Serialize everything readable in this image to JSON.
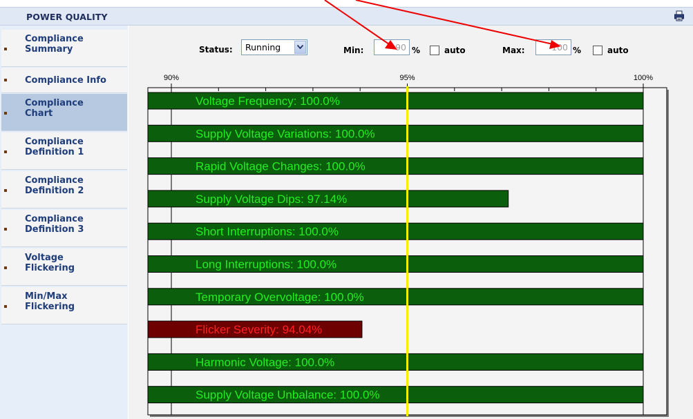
{
  "header": {
    "title": "POWER QUALITY",
    "print_icon": "printer-icon"
  },
  "sidebar": {
    "items": [
      {
        "label": "Compliance\nSummary",
        "active": false
      },
      {
        "label": "Compliance Info",
        "active": false
      },
      {
        "label": "Compliance\nChart",
        "active": true
      },
      {
        "label": "Compliance\nDefinition 1",
        "active": false
      },
      {
        "label": "Compliance\nDefinition 2",
        "active": false
      },
      {
        "label": "Compliance\nDefinition 3",
        "active": false
      },
      {
        "label": "Voltage\nFlickering",
        "active": false
      },
      {
        "label": "Min/Max\nFlickering",
        "active": false
      }
    ]
  },
  "controls": {
    "status_label": "Status:",
    "status_value": "Running",
    "min_label": "Min:",
    "min_value": "90",
    "min_unit": "%",
    "min_auto_label": "auto",
    "max_label": "Max:",
    "max_value": "100",
    "max_unit": "%",
    "max_auto_label": "auto"
  },
  "colors": {
    "bar_ok": "#0b5e0b",
    "bar_fail": "#6e0000",
    "label_ok": "#22ee22",
    "label_fail": "#ff2020",
    "threshold_line": "#f4f000",
    "annotation_arrow": "#ee0000"
  },
  "chart_data": {
    "type": "bar",
    "orientation": "horizontal",
    "x_range": [
      90,
      100
    ],
    "x_ticks": [
      90,
      95,
      100
    ],
    "x_tick_labels": [
      "90%",
      "95%",
      "100%"
    ],
    "threshold": 95,
    "categories": [
      "Voltage Frequency",
      "Supply Voltage Variations",
      "Rapid Voltage Changes",
      "Supply Voltage Dips",
      "Short Interruptions",
      "Long Interruptions",
      "Temporary Overvoltage",
      "Flicker Severity",
      "Harmonic Voltage",
      "Supply Voltage Unbalance"
    ],
    "values": [
      100.0,
      100.0,
      100.0,
      97.14,
      100.0,
      100.0,
      100.0,
      94.04,
      100.0,
      100.0
    ],
    "labels": [
      "Voltage Frequency: 100.0%",
      "Supply Voltage Variations: 100.0%",
      "Rapid Voltage Changes: 100.0%",
      "Supply Voltage Dips: 97.14%",
      "Short Interruptions: 100.0%",
      "Long Interruptions: 100.0%",
      "Temporary Overvoltage: 100.0%",
      "Flicker Severity: 94.04%",
      "Harmonic Voltage: 100.0%",
      "Supply Voltage Unbalance: 100.0%"
    ]
  }
}
